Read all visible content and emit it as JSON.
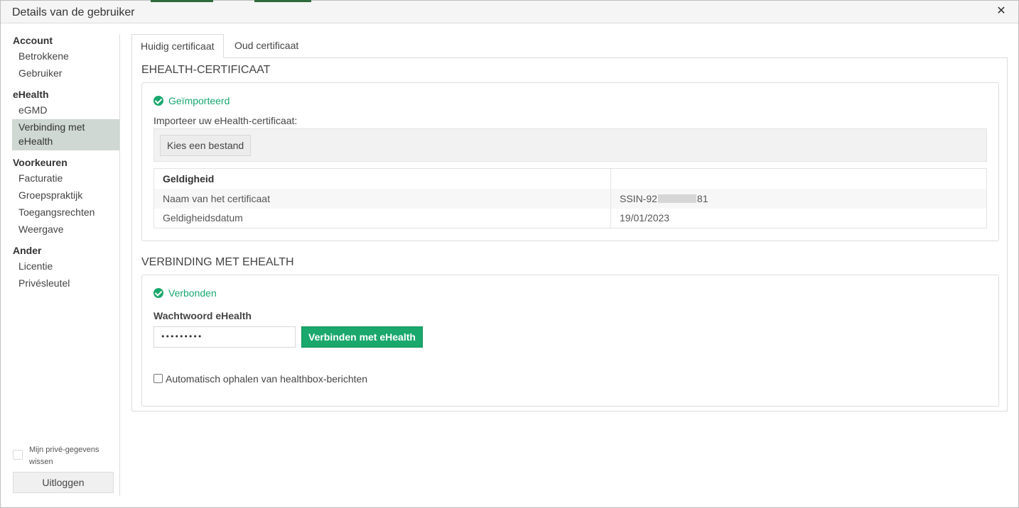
{
  "window": {
    "title": "Details van de gebruiker"
  },
  "sidebar": {
    "groups": [
      {
        "title": "Account",
        "items": [
          "Betrokkene",
          "Gebruiker"
        ]
      },
      {
        "title": "eHealth",
        "items": [
          "eGMD",
          "Verbinding met eHealth"
        ]
      },
      {
        "title": "Voorkeuren",
        "items": [
          "Facturatie",
          "Groepspraktijk",
          "Toegangsrechten",
          "Weergave"
        ]
      },
      {
        "title": "Ander",
        "items": [
          "Licentie",
          "Privésleutel"
        ]
      }
    ],
    "active_item": "Verbinding met eHealth",
    "privacy_label": "Mijn privé-gegevens wissen",
    "logout_label": "Uitloggen"
  },
  "tabs": [
    {
      "label": "Huidig certificaat",
      "active": true
    },
    {
      "label": "Oud certificaat",
      "active": false
    }
  ],
  "certificate": {
    "section_title": "EHEALTH-CERTIFICAAT",
    "status": "Geïmporteerd",
    "import_label": "Importeer uw eHealth-certificaat:",
    "file_button": "Kies een bestand",
    "table": {
      "header": "Geldigheid",
      "rows": [
        {
          "label": "Naam van het certificaat",
          "value_prefix": "SSIN-92",
          "value_suffix": "81"
        },
        {
          "label": "Geldigheidsdatum",
          "value": "19/01/2023"
        }
      ]
    }
  },
  "connection": {
    "section_title": "VERBINDING MET EHEALTH",
    "status": "Verbonden",
    "password_label": "Wachtwoord eHealth",
    "password_masked": "•••••••••",
    "connect_button": "Verbinden met eHealth",
    "auto_fetch_label": "Automatisch ophalen van healthbox-berichten",
    "auto_fetch_checked": false
  },
  "colors": {
    "accent": "#1aa86d",
    "active_nav_bg": "#cfd8d3"
  }
}
